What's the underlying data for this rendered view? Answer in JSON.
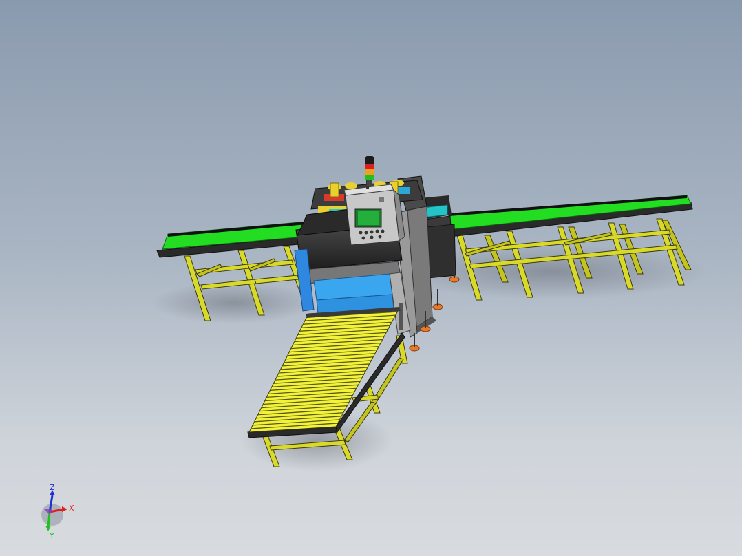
{
  "viewport": {
    "background_top": "#8a9aae",
    "background_bottom": "#d8dbdf"
  },
  "model": {
    "frame_color": "#d9d92a",
    "belt_color": "#22dd22",
    "roller_color": "#f2f23c",
    "housing_color": "#2e2e2e",
    "panel_color": "#2ea8ee",
    "accent_orange": "#e87a2a",
    "signal_tower": [
      "#1c1c1c",
      "#d82020",
      "#f0a020",
      "#20c020"
    ]
  },
  "triad": {
    "z_label": "Z",
    "x_label": "X",
    "y_label": "Y",
    "x_color": "#e02020",
    "y_color": "#20c020",
    "z_color": "#2030d0"
  }
}
